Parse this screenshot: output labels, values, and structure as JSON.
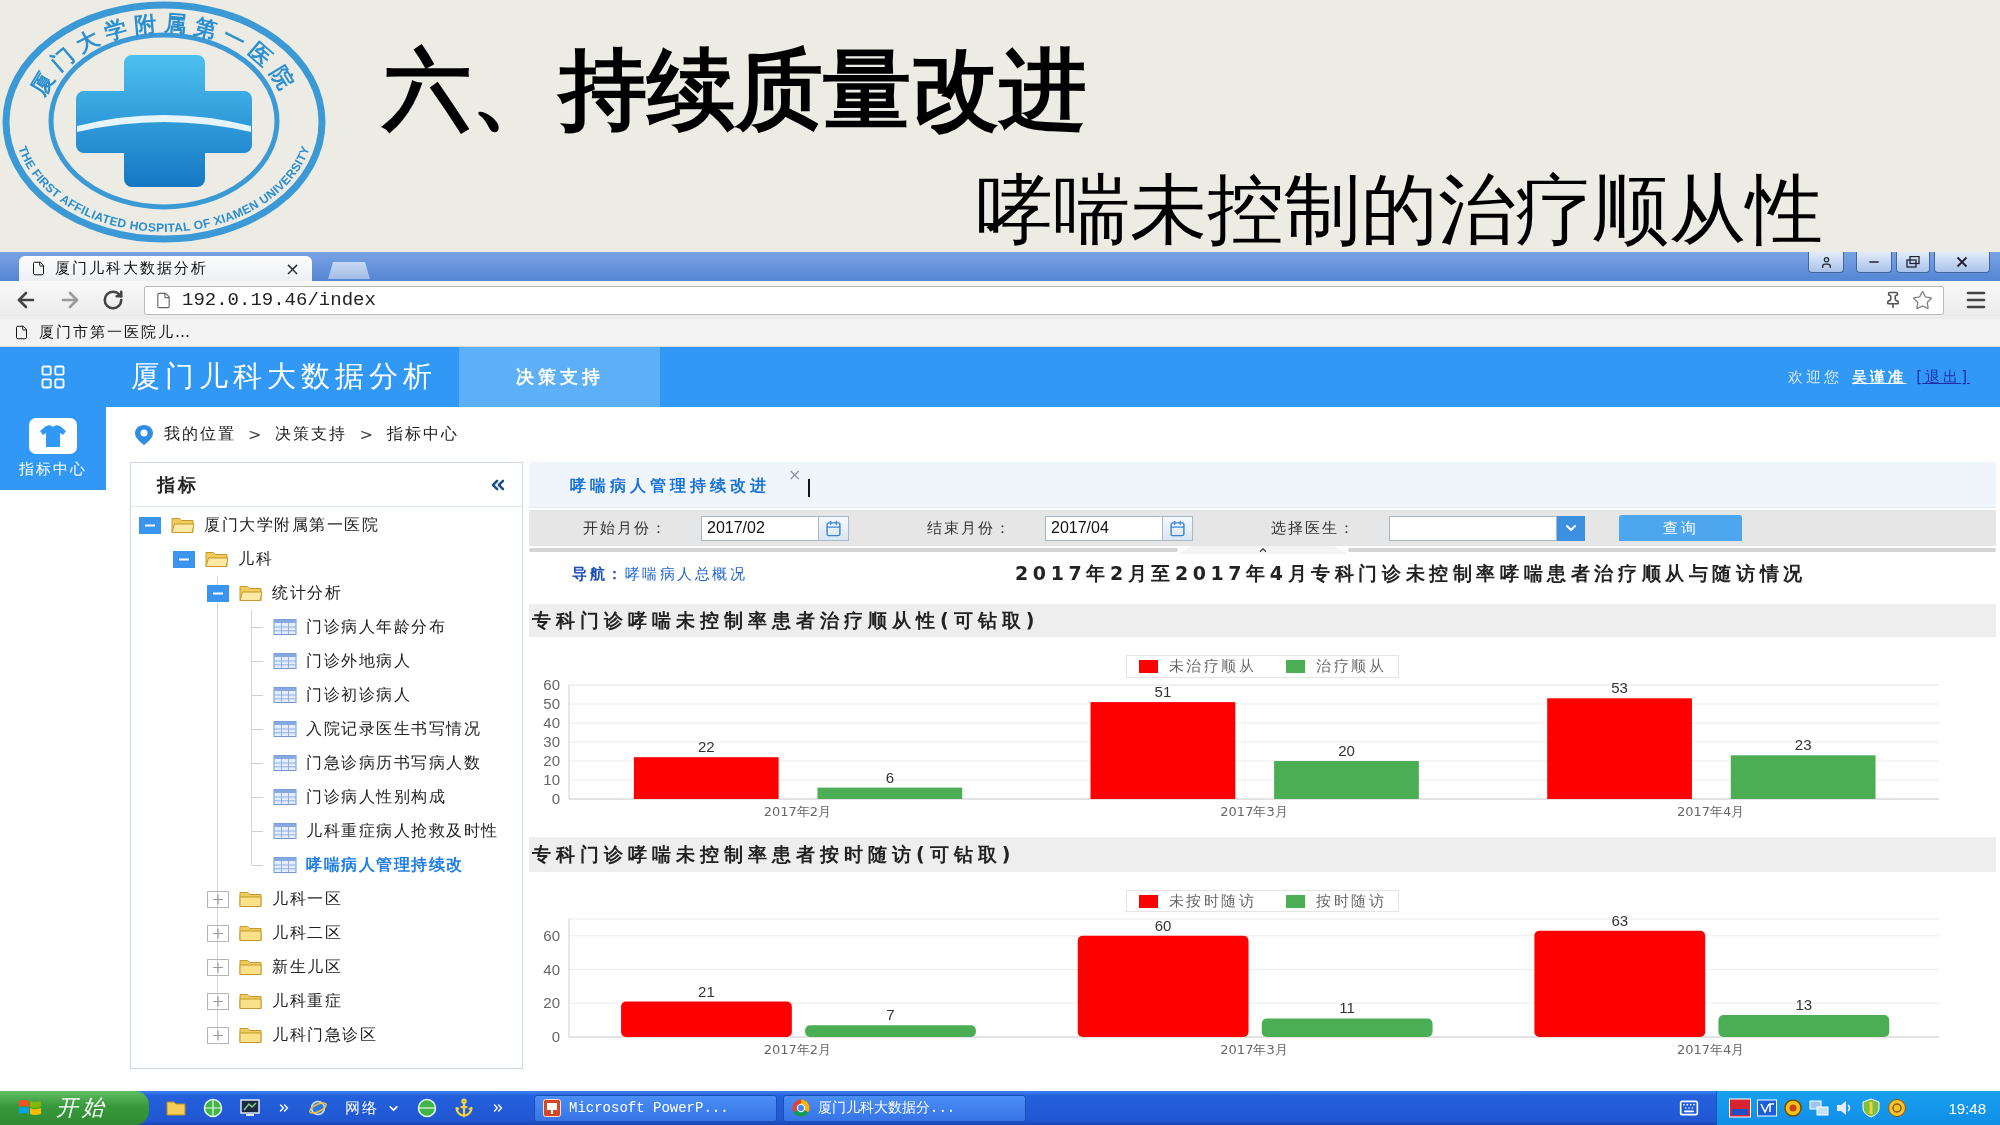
{
  "slide": {
    "logo": {
      "name_cn": "厦门大学附属第一医院",
      "name_en": "THE FIRST AFFILIATED HOSPITAL OF XIAMEN UNIVERSITY"
    },
    "title": "六、持续质量改进",
    "subtitle": "哮喘未控制的治疗顺从性"
  },
  "browser": {
    "tabs": [
      {
        "title": "厦门儿科大数据分析",
        "close": "×",
        "selected": true
      }
    ],
    "url": "192.0.19.46/index",
    "bookmarks": [
      {
        "label": "厦门市第一医院儿…"
      }
    ]
  },
  "app": {
    "title": "厦门儿科大数据分析",
    "nav_tabs": [
      {
        "label": "决策支持",
        "selected": true
      }
    ],
    "welcome": "欢迎您",
    "user": "吴谨准",
    "logout": "[退出]"
  },
  "sidebar": {
    "items": [
      {
        "label": "指标中心",
        "selected": true
      }
    ]
  },
  "breadcrumb": {
    "items": [
      "我的位置",
      "决策支持",
      "指标中心"
    ],
    "separator": ">"
  },
  "tree": {
    "title": "指标",
    "items": [
      {
        "label": "厦门大学附属第一医院",
        "kind": "folder",
        "expanded": true,
        "selected": false,
        "children": [
          {
            "label": "儿科",
            "kind": "folder",
            "expanded": true,
            "selected": false,
            "children": [
              {
                "label": "统计分析",
                "kind": "folder",
                "expanded": true,
                "selected": false,
                "children": [
                  {
                    "label": "门诊病人年龄分布",
                    "kind": "page",
                    "selected": false
                  },
                  {
                    "label": "门诊外地病人",
                    "kind": "page",
                    "selected": false
                  },
                  {
                    "label": "门诊初诊病人",
                    "kind": "page",
                    "selected": false
                  },
                  {
                    "label": "入院记录医生书写情况",
                    "kind": "page",
                    "selected": false
                  },
                  {
                    "label": "门急诊病历书写病人数",
                    "kind": "page",
                    "selected": false
                  },
                  {
                    "label": "门诊病人性别构成",
                    "kind": "page",
                    "selected": false
                  },
                  {
                    "label": "儿科重症病人抢救及时性",
                    "kind": "page",
                    "selected": false
                  },
                  {
                    "label": "哮喘病人管理持续改",
                    "kind": "page",
                    "selected": true
                  }
                ]
              },
              {
                "label": "儿科一区",
                "kind": "folder",
                "expanded": false,
                "selected": false
              },
              {
                "label": "儿科二区",
                "kind": "folder",
                "expanded": false,
                "selected": false
              },
              {
                "label": "新生儿区",
                "kind": "folder",
                "expanded": false,
                "selected": false
              },
              {
                "label": "儿科重症",
                "kind": "folder",
                "expanded": false,
                "selected": false
              },
              {
                "label": "儿科门急诊区",
                "kind": "folder",
                "expanded": false,
                "selected": false
              }
            ]
          }
        ]
      }
    ]
  },
  "content": {
    "tabs": [
      {
        "label": "哮喘病人管理持续改进",
        "close": "×",
        "selected": true
      }
    ],
    "filters": [
      {
        "kind": "month",
        "label": "开始月份：",
        "value": "2017/02"
      },
      {
        "kind": "month",
        "label": "结束月份：",
        "value": "2017/04"
      },
      {
        "kind": "select",
        "label": "选择医生："
      }
    ],
    "query_button": "查询",
    "nav": {
      "label": "导航：",
      "link": "哮喘病人总概况"
    },
    "report_title": "2017年2月至2017年4月专科门诊未控制率哮喘患者治疗顺从与随访情况",
    "sections": [
      {
        "title": "专科门诊哮喘未控制率患者治疗顺从性(可钻取)",
        "chart_data": {
          "type": "bar",
          "categories": [
            "2017年2月",
            "2017年3月",
            "2017年4月"
          ],
          "series": [
            {
              "name": "未治疗顺从",
              "color": "#ff0000",
              "values": [
                22,
                51,
                53
              ]
            },
            {
              "name": "治疗顺从",
              "color": "#4cae54",
              "values": [
                6,
                20,
                23
              ]
            }
          ],
          "ylim": [
            0,
            60
          ],
          "yticks": [
            0,
            10,
            20,
            30,
            40,
            50,
            60
          ],
          "grid": true,
          "legend": "top",
          "data_labels": true
        }
      },
      {
        "title": "专科门诊哮喘未控制率患者按时随访(可钻取)",
        "chart_data": {
          "type": "bar",
          "categories": [
            "2017年2月",
            "2017年3月",
            "2017年4月"
          ],
          "series": [
            {
              "name": "未按时随访",
              "color": "#ff0000",
              "values": [
                21,
                60,
                63
              ]
            },
            {
              "name": "按时随访",
              "color": "#4cae54",
              "values": [
                7,
                11,
                13
              ]
            }
          ],
          "ylim": [
            0,
            70
          ],
          "yticks": [
            0,
            20,
            40,
            60
          ],
          "grid": true,
          "legend": "top",
          "data_labels": true
        }
      }
    ]
  },
  "taskbar": {
    "start": "开始",
    "toolbar": "网络",
    "tasks": [
      {
        "label": "Microsoft PowerP..."
      },
      {
        "label": "厦门儿科大数据分..."
      }
    ],
    "clock": "19:48"
  }
}
